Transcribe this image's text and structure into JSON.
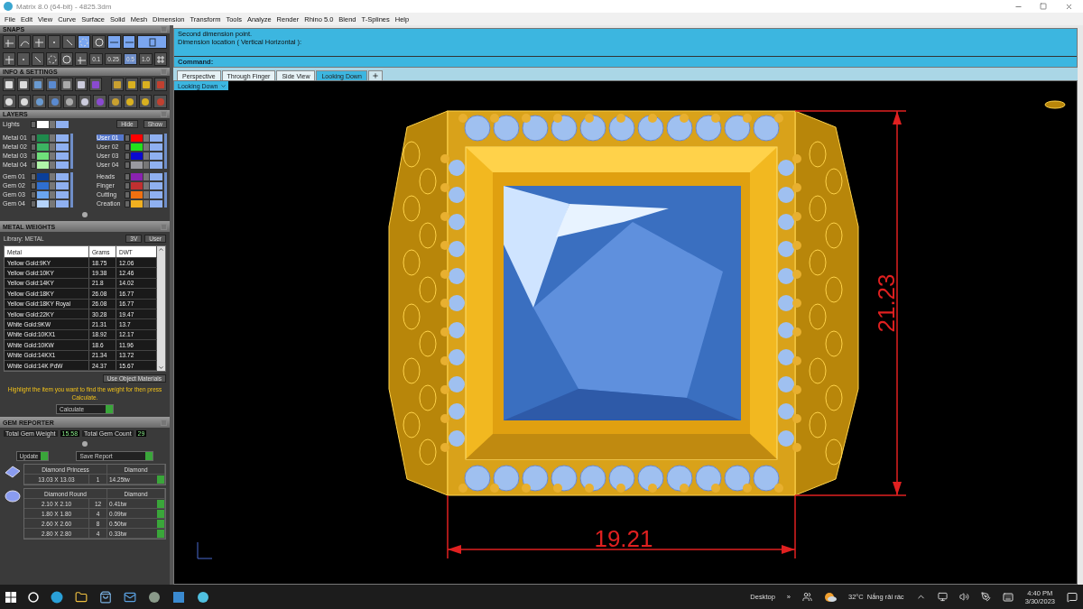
{
  "window": {
    "title": "Matrix 8.0 (64-bit) - 4825.3dm"
  },
  "menu": [
    "File",
    "Edit",
    "View",
    "Curve",
    "Surface",
    "Solid",
    "Mesh",
    "Dimension",
    "Transform",
    "Tools",
    "Analyze",
    "Render",
    "Rhino 5.0",
    "Blend",
    "T-Splines",
    "Help"
  ],
  "snaps": {
    "title": "SNAPS",
    "toggles": [
      {
        "on": false
      },
      {
        "on": false
      },
      {
        "on": false
      },
      {
        "on": false
      },
      {
        "on": false
      },
      {
        "on": true
      },
      {
        "on": false
      },
      {
        "on": true
      },
      {
        "on": true
      }
    ],
    "steps": [
      {
        "label": "0.1",
        "selected": false
      },
      {
        "label": "0.25",
        "selected": false
      },
      {
        "label": "0.5",
        "selected": true
      },
      {
        "label": "1.0",
        "selected": false
      }
    ]
  },
  "info_settings": {
    "title": "INFO & SETTINGS"
  },
  "layers": {
    "title": "LAYERS",
    "lights": {
      "label": "Lights",
      "color": "#ffffff",
      "visible": true
    },
    "hide": "Hide",
    "show": "Show",
    "left": [
      [
        {
          "name": "Metal 01",
          "color": "#1f8a4c",
          "selected": false,
          "visible": true
        },
        {
          "name": "Metal 02",
          "color": "#3cb462",
          "selected": false,
          "visible": true
        },
        {
          "name": "Metal 03",
          "color": "#6fe07a",
          "selected": false,
          "visible": true
        },
        {
          "name": "Metal 04",
          "color": "#b0f5a8",
          "selected": false,
          "visible": true
        }
      ],
      [
        {
          "name": "Gem 01",
          "color": "#0a3f9a",
          "selected": false,
          "visible": true
        },
        {
          "name": "Gem 02",
          "color": "#2f6fd0",
          "selected": false,
          "visible": true
        },
        {
          "name": "Gem 03",
          "color": "#6aa5f0",
          "selected": false,
          "visible": true
        },
        {
          "name": "Gem 04",
          "color": "#b5d3fa",
          "selected": false,
          "visible": true
        }
      ]
    ],
    "right": [
      [
        {
          "name": "User 01",
          "color": "#ff0000",
          "selected": true,
          "visible": true
        },
        {
          "name": "User 02",
          "color": "#22e01b",
          "selected": false,
          "visible": true
        },
        {
          "name": "User 03",
          "color": "#0a0ad0",
          "selected": false,
          "visible": true
        },
        {
          "name": "User 04",
          "color": "#9a9aa0",
          "selected": false,
          "visible": true
        }
      ],
      [
        {
          "name": "Heads",
          "color": "#8a22b0",
          "selected": false,
          "visible": true
        },
        {
          "name": "Finger",
          "color": "#c03030",
          "selected": false,
          "visible": true
        },
        {
          "name": "Cutting",
          "color": "#f07010",
          "selected": false,
          "visible": true
        },
        {
          "name": "Creation",
          "color": "#f0b020",
          "selected": false,
          "visible": true
        }
      ]
    ]
  },
  "metal_weights": {
    "title": "METAL WEIGHTS",
    "library": "Library: METAL",
    "toggles": [
      "3V",
      "User"
    ],
    "columns": [
      "Metal",
      "Grams",
      "DWT"
    ],
    "rows": [
      [
        "Yellow Gold:9KY",
        "18.75",
        "12.06"
      ],
      [
        "Yellow Gold:10KY",
        "19.38",
        "12.46"
      ],
      [
        "Yellow Gold:14KY",
        "21.8",
        "14.02"
      ],
      [
        "Yellow Gold:18KY",
        "26.08",
        "16.77"
      ],
      [
        "Yellow Gold:18KY Royal",
        "26.08",
        "16.77"
      ],
      [
        "Yellow Gold:22KY",
        "30.28",
        "19.47"
      ],
      [
        "White Gold:9KW",
        "21.31",
        "13.7"
      ],
      [
        "White Gold:10KX1",
        "18.92",
        "12.17"
      ],
      [
        "White Gold:10KW",
        "18.6",
        "11.96"
      ],
      [
        "White Gold:14KX1",
        "21.34",
        "13.72"
      ],
      [
        "White Gold:14K PdW",
        "24.37",
        "15.67"
      ]
    ],
    "use_object_materials": "Use Object Materials",
    "hint": "Highlight the item you want to find the weight for then press Calculate.",
    "calculate": "Calculate"
  },
  "gem_reporter": {
    "title": "GEM REPORTER",
    "weight_label": "Total Gem Weight",
    "weight": "15.58",
    "count_label": "Total Gem Count",
    "count": "29",
    "update": "Update",
    "save": "Save Report",
    "groups": [
      {
        "kind": "princess",
        "name": "Diamond Princess",
        "material": "Diamond",
        "rows": [
          {
            "size": "13.03 X 13.03",
            "count": "1",
            "weight": "14.25tw"
          }
        ]
      },
      {
        "kind": "round",
        "name": "Diamond Round",
        "material": "Diamond",
        "rows": [
          {
            "size": "2.10 X 2.10",
            "count": "12",
            "weight": "0.41tw"
          },
          {
            "size": "1.80 X 1.80",
            "count": "4",
            "weight": "0.09tw"
          },
          {
            "size": "2.60 X 2.60",
            "count": "8",
            "weight": "0.50tw"
          },
          {
            "size": "2.80 X 2.80",
            "count": "4",
            "weight": "0.33tw"
          }
        ]
      }
    ]
  },
  "command": {
    "lines": [
      "Second dimension point.",
      "Dimension location ( Vertical  Horizontal ):"
    ],
    "label": "Command:"
  },
  "viewport_tabs": [
    {
      "label": "Perspective",
      "selected": false
    },
    {
      "label": "Through Finger",
      "selected": false
    },
    {
      "label": "Side View",
      "selected": false
    },
    {
      "label": "Looking Down",
      "selected": true
    }
  ],
  "view_menu": "Looking Down",
  "viewport": {
    "width_dimension": "19.21",
    "height_dimension": "21.23"
  },
  "taskbar": {
    "desktop": "Desktop",
    "more": "»",
    "temperature": "32°C",
    "weather": "Nắng rải rác",
    "time": "4:40 PM",
    "date": "3/30/2023"
  }
}
